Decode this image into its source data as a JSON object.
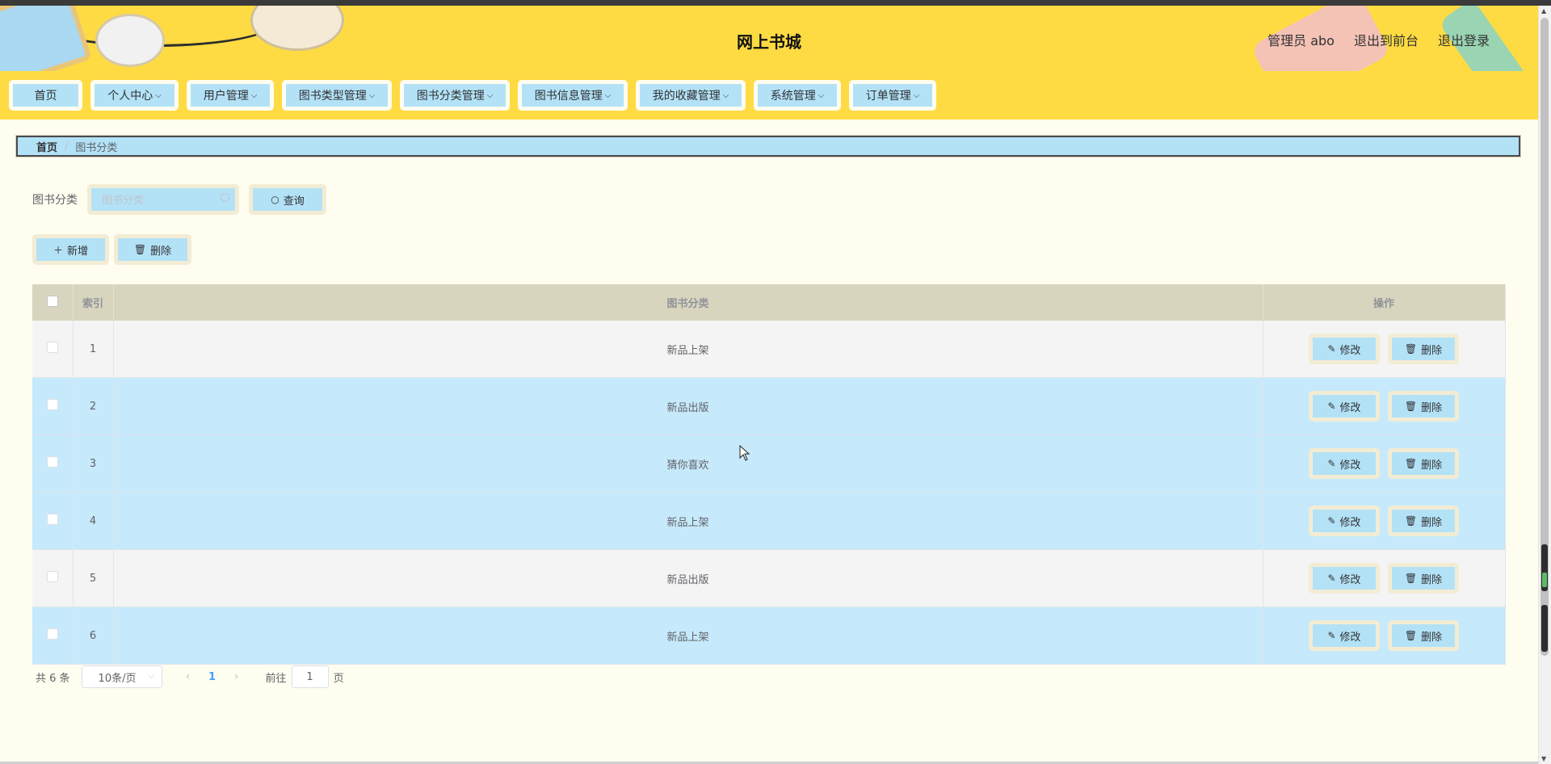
{
  "header": {
    "title": "网上书城",
    "links": [
      "管理员 abo",
      "退出到前台",
      "退出登录"
    ]
  },
  "menu": {
    "items": [
      {
        "label": "首页",
        "has_arrow": false
      },
      {
        "label": "个人中心",
        "has_arrow": true
      },
      {
        "label": "用户管理",
        "has_arrow": true
      },
      {
        "label": "图书类型管理",
        "has_arrow": true
      },
      {
        "label": "图书分类管理",
        "has_arrow": true
      },
      {
        "label": "图书信息管理",
        "has_arrow": true
      },
      {
        "label": "我的收藏管理",
        "has_arrow": true
      },
      {
        "label": "系统管理",
        "has_arrow": true
      },
      {
        "label": "订单管理",
        "has_arrow": true
      }
    ]
  },
  "breadcrumb": {
    "home": "首页",
    "separator": "/",
    "current": "图书分类"
  },
  "search": {
    "label": "图书分类",
    "placeholder": "图书分类",
    "value": "",
    "button": "查询"
  },
  "actions": {
    "add": "新增",
    "delete": "删除"
  },
  "table": {
    "columns": [
      "索引",
      "图书分类",
      "操作"
    ],
    "rows": [
      {
        "index": "1",
        "category": "新品上架"
      },
      {
        "index": "2",
        "category": "新品出版"
      },
      {
        "index": "3",
        "category": "猜你喜欢"
      },
      {
        "index": "4",
        "category": "新品上架"
      },
      {
        "index": "5",
        "category": "新品出版"
      },
      {
        "index": "6",
        "category": "新品上架"
      }
    ],
    "edit_label": "修改",
    "delete_label": "删除"
  },
  "pagination": {
    "total": "共 6 条",
    "page_size": "10条/页",
    "current_page": "1",
    "goto_prefix": "前往",
    "goto_value": "1",
    "goto_suffix": "页"
  },
  "colors": {
    "header_bg": "#fedb42",
    "accent_blue": "#b3e2f7",
    "row_highlight": "#c6e9fb",
    "page_bg": "#fffdf0",
    "table_header": "#d8d5bf"
  }
}
